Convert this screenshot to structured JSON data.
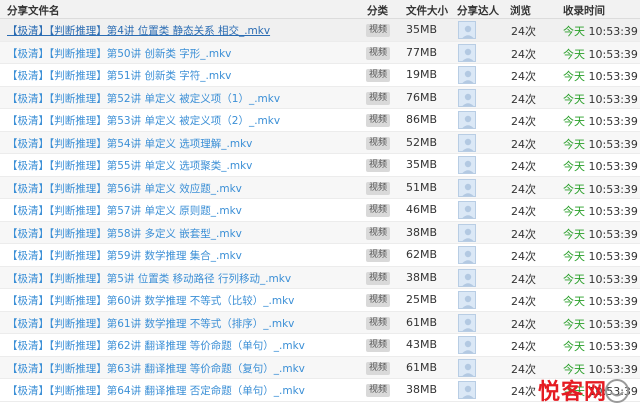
{
  "header": {
    "name": "分享文件名",
    "type": "分类",
    "size": "文件大小",
    "user": "分享达人",
    "views": "浏览",
    "time": "收录时间"
  },
  "rows": [
    {
      "name": "【极清】【判断推理】第4讲 位置类 静态关系 相交_.mkv",
      "type": "视频",
      "size": "35MB",
      "views": "24次",
      "today": "今天",
      "time": "10:53:39"
    },
    {
      "name": "【极清】【判断推理】第50讲 创新类 字形_.mkv",
      "type": "视频",
      "size": "77MB",
      "views": "24次",
      "today": "今天",
      "time": "10:53:39"
    },
    {
      "name": "【极清】【判断推理】第51讲 创新类 字符_.mkv",
      "type": "视频",
      "size": "19MB",
      "views": "24次",
      "today": "今天",
      "time": "10:53:39"
    },
    {
      "name": "【极清】【判断推理】第52讲 单定义 被定义项（1）_.mkv",
      "type": "视频",
      "size": "76MB",
      "views": "24次",
      "today": "今天",
      "time": "10:53:39"
    },
    {
      "name": "【极清】【判断推理】第53讲 单定义 被定义项（2）_.mkv",
      "type": "视频",
      "size": "86MB",
      "views": "24次",
      "today": "今天",
      "time": "10:53:39"
    },
    {
      "name": "【极清】【判断推理】第54讲 单定义 选项理解_.mkv",
      "type": "视频",
      "size": "52MB",
      "views": "24次",
      "today": "今天",
      "time": "10:53:39"
    },
    {
      "name": "【极清】【判断推理】第55讲 单定义 选项聚类_.mkv",
      "type": "视频",
      "size": "35MB",
      "views": "24次",
      "today": "今天",
      "time": "10:53:39"
    },
    {
      "name": "【极清】【判断推理】第56讲 单定义 效应题_.mkv",
      "type": "视频",
      "size": "51MB",
      "views": "24次",
      "today": "今天",
      "time": "10:53:39"
    },
    {
      "name": "【极清】【判断推理】第57讲 单定义 原则题_.mkv",
      "type": "视频",
      "size": "46MB",
      "views": "24次",
      "today": "今天",
      "time": "10:53:39"
    },
    {
      "name": "【极清】【判断推理】第58讲 多定义 嵌套型_.mkv",
      "type": "视频",
      "size": "38MB",
      "views": "24次",
      "today": "今天",
      "time": "10:53:39"
    },
    {
      "name": "【极清】【判断推理】第59讲 数学推理 集合_.mkv",
      "type": "视频",
      "size": "62MB",
      "views": "24次",
      "today": "今天",
      "time": "10:53:39"
    },
    {
      "name": "【极清】【判断推理】第5讲 位置类 移动路径 行列移动_.mkv",
      "type": "视频",
      "size": "38MB",
      "views": "24次",
      "today": "今天",
      "time": "10:53:39"
    },
    {
      "name": "【极清】【判断推理】第60讲 数学推理 不等式（比较）_.mkv",
      "type": "视频",
      "size": "25MB",
      "views": "24次",
      "today": "今天",
      "time": "10:53:39"
    },
    {
      "name": "【极清】【判断推理】第61讲 数学推理 不等式（排序）_.mkv",
      "type": "视频",
      "size": "61MB",
      "views": "24次",
      "today": "今天",
      "time": "10:53:39"
    },
    {
      "name": "【极清】【判断推理】第62讲 翻译推理 等价命题（单句）_.mkv",
      "type": "视频",
      "size": "43MB",
      "views": "24次",
      "today": "今天",
      "time": "10:53:39"
    },
    {
      "name": "【极清】【判断推理】第63讲 翻译推理 等价命题（复句）_.mkv",
      "type": "视频",
      "size": "61MB",
      "views": "24次",
      "today": "今天",
      "time": "10:53:39"
    },
    {
      "name": "【极清】【判断推理】第64讲 翻译推理 否定命题（单句）_.mkv",
      "type": "视频",
      "size": "38MB",
      "views": "24次",
      "today": "今天",
      "time": "10:53:39"
    }
  ],
  "watermark": {
    "text": "悦客网",
    "icon": "smile-logo-icon"
  },
  "colors": {
    "link": "#3b8fd6",
    "today": "#2aa02a",
    "watermark": "#e51c23"
  }
}
